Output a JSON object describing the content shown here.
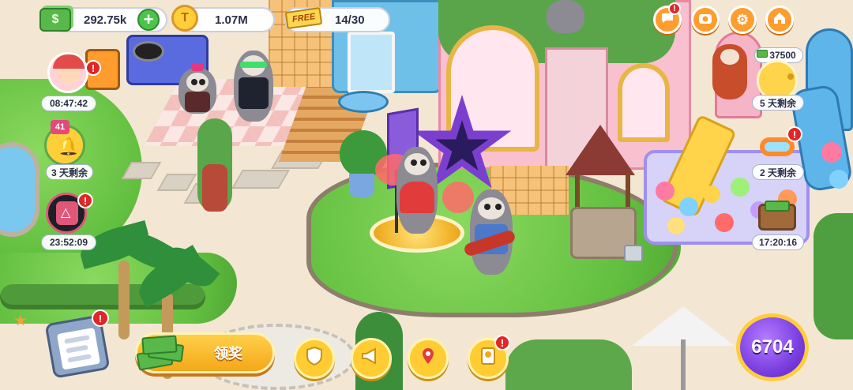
{
  "hud": {
    "cash_value": "292.75k",
    "coins_value": "1.07M",
    "free_label": "FREE",
    "tickets_value": "14/30"
  },
  "left_rail": {
    "avatar_timer": "08:47:42",
    "bell_level": "41",
    "bell_label": "3 天剩余",
    "squid_timer": "23:52:09"
  },
  "right_rail": {
    "piggy_amount": "37500",
    "piggy_label": "5 天剩余",
    "goggles_label": "2 天剩余",
    "cash_chest_timer": "17:20:16"
  },
  "bottom_bar": {
    "claim_label": "领奖",
    "energy_value": "6704"
  },
  "alerts": {
    "badge": "!"
  },
  "icons": {
    "chat": "chat-bubble-icon",
    "camera": "camera-icon",
    "settings": "gear-icon",
    "home": "home-icon",
    "shield": "shield-icon",
    "megaphone": "megaphone-icon",
    "map": "map-pin-icon",
    "notebook": "notebook-icon"
  },
  "colors": {
    "accent_orange": "#ff9d2e",
    "gold": "#ffcc33",
    "energy_purple": "#7b3fe0",
    "alert_red": "#e02626",
    "cash_green": "#59b84a"
  }
}
